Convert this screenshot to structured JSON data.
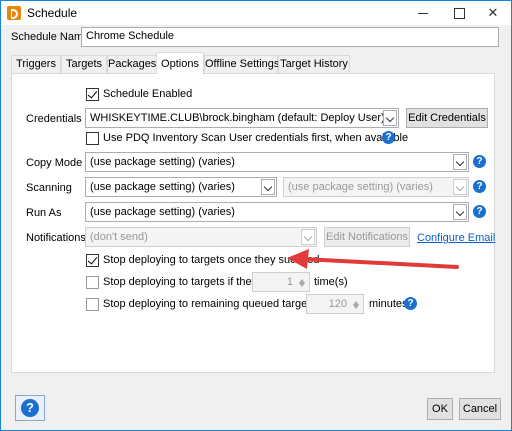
{
  "window": {
    "title": "Schedule",
    "controls": {
      "minimize": "—",
      "maximize": "☐",
      "close": "✕"
    }
  },
  "schedule_name": {
    "label": "Schedule Name",
    "value": "Chrome Schedule"
  },
  "tabs": [
    {
      "label": "Triggers",
      "active": false
    },
    {
      "label": "Targets",
      "active": false
    },
    {
      "label": "Packages",
      "active": false
    },
    {
      "label": "Options",
      "active": true
    },
    {
      "label": "Offline Settings",
      "active": false
    },
    {
      "label": "Target History",
      "active": false
    }
  ],
  "options": {
    "schedule_enabled": {
      "label": "Schedule Enabled",
      "checked": true
    },
    "credentials": {
      "label": "Credentials",
      "value": "WHISKEYTIME.CLUB\\brock.bingham (default: Deploy User)",
      "edit_button": "Edit Credentials"
    },
    "use_pdq_inventory": {
      "label": "Use PDQ Inventory Scan User credentials first, when available",
      "checked": false
    },
    "copy_mode": {
      "label": "Copy Mode",
      "value": "(use package setting) (varies)"
    },
    "scanning": {
      "label": "Scanning",
      "value": "(use package setting) (varies)",
      "secondary_value": "(use package setting) (varies)"
    },
    "run_as": {
      "label": "Run As",
      "value": "(use package setting) (varies)"
    },
    "notifications": {
      "label": "Notifications",
      "value": "(don't send)",
      "edit_button": "Edit Notifications",
      "configure_link": "Configure Email"
    },
    "stop_on_success": {
      "label": "Stop deploying to targets once they succeed",
      "checked": true
    },
    "stop_on_fail": {
      "label": "Stop deploying to targets if they fail",
      "checked": false,
      "count": "1",
      "suffix": "time(s)"
    },
    "stop_queued": {
      "label": "Stop deploying to remaining queued targets after",
      "checked": false,
      "minutes": "120",
      "suffix": "minutes"
    }
  },
  "footer": {
    "ok": "OK",
    "cancel": "Cancel"
  },
  "icons": {
    "help": "?",
    "help_color": "#1a6fd0",
    "arrow_color": "#e03a3a"
  }
}
